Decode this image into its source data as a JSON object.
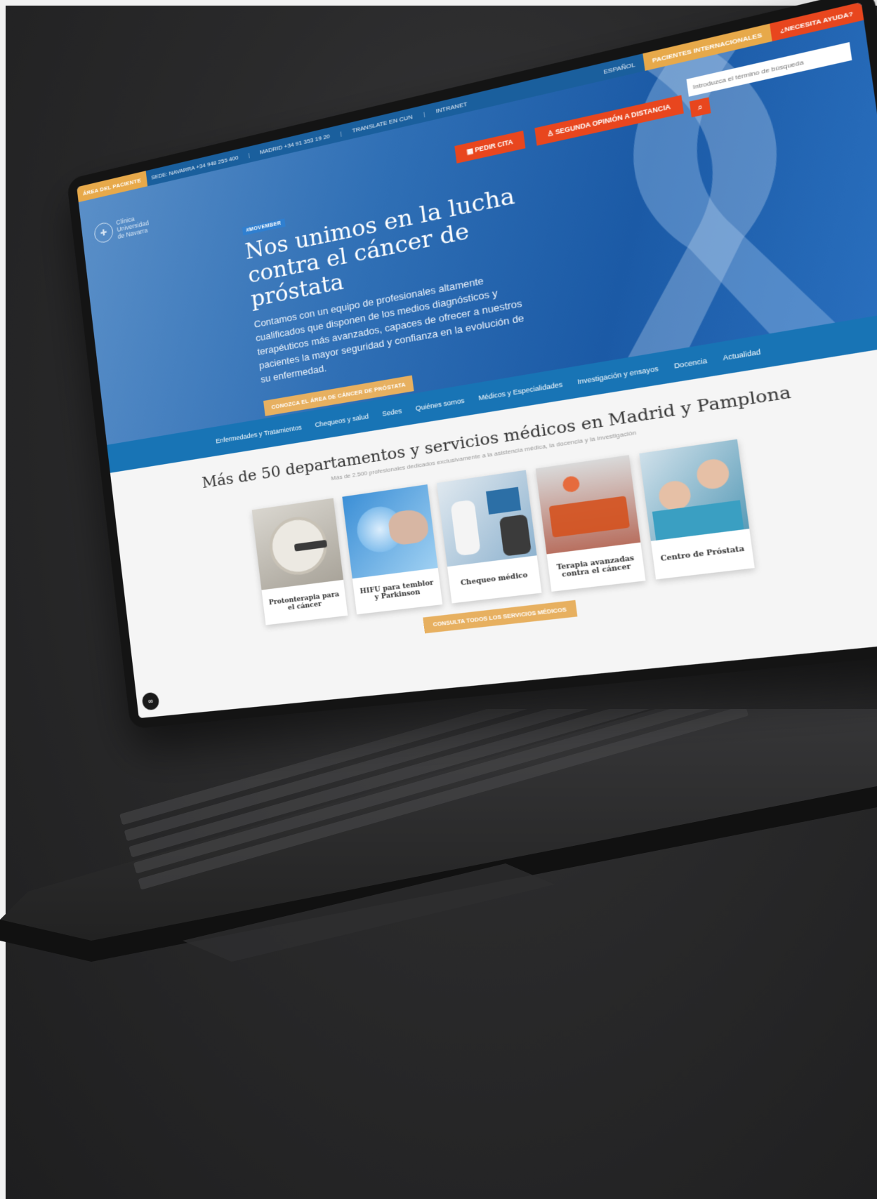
{
  "utility_bar": {
    "patient_area": "ÁREA DEL PACIENTE",
    "phone_pamplona": "SEDE: NAVARRA +34 948 255 400",
    "phone_madrid": "MADRID +34 91 353 19 20",
    "translate": "TRANSLATE EN CUN",
    "intranet": "INTRANET",
    "language": "ESPAÑOL",
    "international": "PACIENTES INTERNACIONALES",
    "help": "¿NECESITA AYUDA?"
  },
  "brand": {
    "line1": "Clínica",
    "line2": "Universidad",
    "line3": "de Navarra"
  },
  "cta": {
    "appointment": "PEDIR CITA",
    "second_opinion": "SEGUNDA OPINIÓN A DISTANCIA"
  },
  "search": {
    "placeholder": "Introduzca el término de búsqueda"
  },
  "hero": {
    "tag": "#MOVEMBER",
    "title": "Nos unimos en la lucha contra el cáncer de próstata",
    "body": "Contamos con un equipo de profesionales altamente cualificados que disponen de los medios diagnósticos y terapéuticos más avanzados, capaces de ofrecer a nuestros pacientes la mayor seguridad y confianza en la evolución de su enfermedad.",
    "button": "CONOZCA EL ÁREA DE CÁNCER DE PRÓSTATA"
  },
  "nav": {
    "items": [
      "Enfermedades y Tratamientos",
      "Chequeos y salud",
      "Sedes",
      "Quiénes somos",
      "Médicos y Especialidades",
      "Investigación y ensayos",
      "Docencia",
      "Actualidad"
    ]
  },
  "services": {
    "title": "Más de 50 departamentos y servicios médicos en Madrid y Pamplona",
    "subtitle": "Más de 2.500 profesionales dedicados exclusivamente a la asistencia médica, la docencia y la investigación",
    "cards": [
      "Protonterapia para el cáncer",
      "HIFU para temblor y Parkinson",
      "Chequeo médico",
      "Terapia avanzadas contra el cáncer",
      "Centro de Próstata"
    ],
    "all_button": "CONSULTA TODOS LOS SERVICIOS MÉDICOS"
  },
  "colors": {
    "brand_blue": "#1874b5",
    "accent_gold": "#e7b060",
    "accent_red": "#e8461e"
  }
}
